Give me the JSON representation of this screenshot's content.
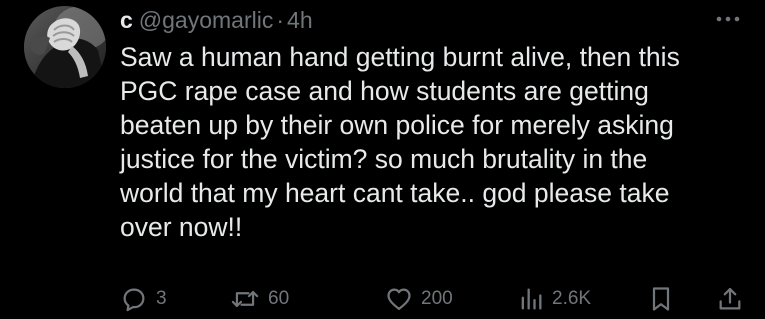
{
  "tweet": {
    "display_name": "c",
    "handle": "@gayomarlic",
    "separator": "·",
    "time": "4h",
    "text": "Saw a human hand getting burnt alive, then this\nPGC rape case and how students are getting\nbeaten up by their own police for merely asking\njustice for the victim? so much brutality in the\nworld that my heart cant take.. god please take\nover now!!"
  },
  "actions": {
    "reply_count": "3",
    "repost_count": "60",
    "like_count": "200",
    "views_count": "2.6K"
  },
  "icons": {
    "more": "more-icon",
    "reply": "reply-icon",
    "repost": "repost-icon",
    "like": "heart-icon",
    "views": "views-icon",
    "bookmark": "bookmark-icon",
    "share": "share-icon"
  },
  "colors": {
    "background": "#000000",
    "text_primary": "#e7e9ea",
    "text_secondary": "#71767b"
  }
}
